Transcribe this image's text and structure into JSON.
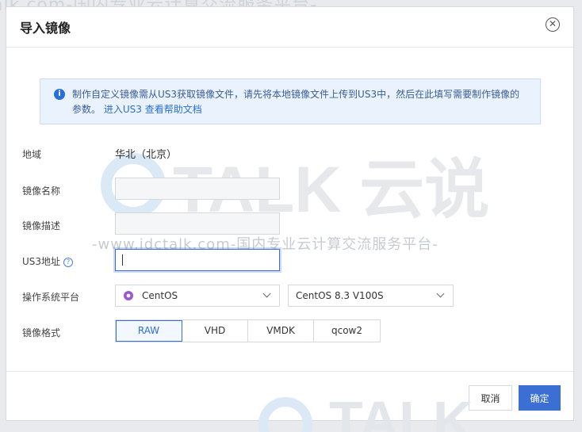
{
  "watermark": {
    "top_text": "alk.com-国内专业云计算交流服务平台-",
    "line_text": "-www.idctalk.com-国内专业云计算交流服务平台-",
    "logo_text": "TALK 云说"
  },
  "dialog": {
    "title": "导入镜像",
    "close_icon": "close-circle-icon"
  },
  "info": {
    "icon": "info-icon",
    "text": "制作自定义镜像需从US3获取镜像文件，请先将本地镜像文件上传到US3中，然后在此填写需要制作镜像的参数。",
    "link_us3": "进入US3",
    "link_help": "查看帮助文档"
  },
  "form": {
    "region": {
      "label": "地域",
      "value": "华北（北京）"
    },
    "image_name": {
      "label": "镜像名称",
      "value": ""
    },
    "image_desc": {
      "label": "镜像描述",
      "value": ""
    },
    "us3_url": {
      "label": "US3地址",
      "value": "",
      "help_icon": "question-circle-icon"
    },
    "os_platform": {
      "label": "操作系统平台",
      "os_family": "CentOS",
      "os_version": "CentOS 8.3 V100S"
    },
    "format": {
      "label": "镜像格式",
      "options": [
        "RAW",
        "VHD",
        "VMDK",
        "qcow2"
      ],
      "selected": "RAW"
    }
  },
  "footer": {
    "cancel": "取消",
    "confirm": "确定"
  },
  "colors": {
    "primary": "#3b6fd4",
    "info_bg": "#eaf3fd",
    "watermark": "#cfd3da"
  }
}
